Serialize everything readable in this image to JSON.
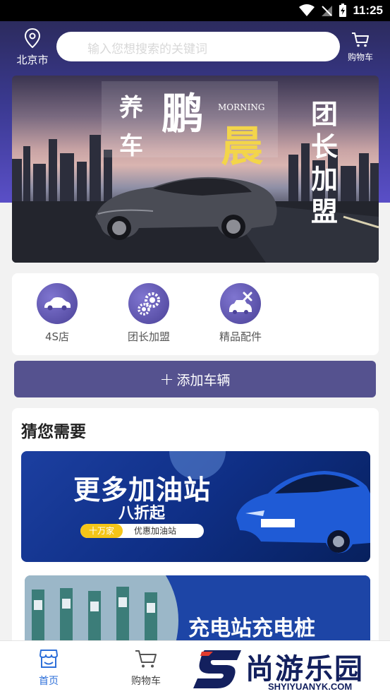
{
  "status_bar": {
    "time": "11:25"
  },
  "header": {
    "location": "北京市",
    "search_placeholder": "输入您想搜索的关键词",
    "cart_label": "购物车"
  },
  "banner": {
    "chars_left": [
      "养",
      "车"
    ],
    "brand_char1": "鹏",
    "brand_char2": "晨",
    "morning": "MORNING",
    "vertical_text": [
      "团",
      "长",
      "加",
      "盟"
    ]
  },
  "quick_entries": [
    {
      "label": "4S店",
      "icon": "car-icon"
    },
    {
      "label": "团长加盟",
      "icon": "gears-icon"
    },
    {
      "label": "精品配件",
      "icon": "car-repair-icon"
    }
  ],
  "add_vehicle": {
    "plus": "+",
    "label": "添加车辆"
  },
  "guess": {
    "title": "猜您需要",
    "card1": {
      "headline": "更多加油站",
      "sub": "八折起",
      "pill_a": "十万家",
      "pill_b": "优惠加油站"
    },
    "card2": {
      "headline": "充电站充电桩"
    }
  },
  "bottom_nav": [
    {
      "label": "首页",
      "icon": "store-icon",
      "active": true
    },
    {
      "label": "购物车",
      "icon": "cart-icon",
      "active": false
    }
  ],
  "watermark": {
    "cn": "尚游乐园",
    "en": "SHYIYUANYK.COM"
  },
  "colors": {
    "accent": "#55528f",
    "active_tab": "#2d6fd9"
  }
}
